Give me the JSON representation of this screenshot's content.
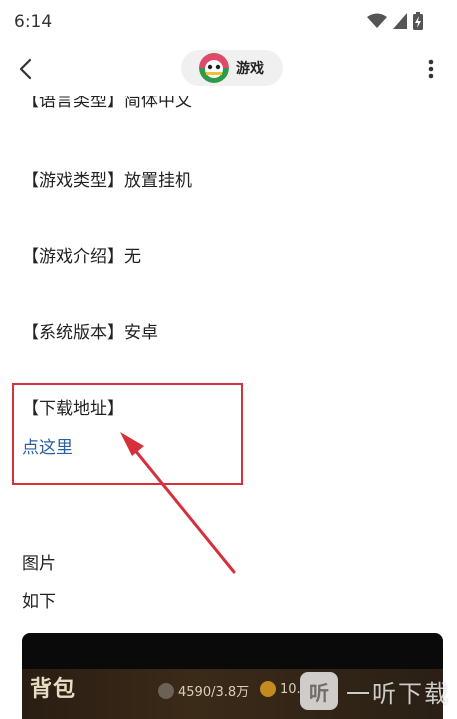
{
  "status_bar": {
    "time": "6:14",
    "icons": [
      "wifi-icon",
      "signal-icon",
      "battery-charging-icon"
    ]
  },
  "app_bar": {
    "back_icon": "chevron-left-icon",
    "title": "游戏",
    "more_icon": "more-vertical-icon"
  },
  "article": {
    "partial_line": "【语言类型】简体中文",
    "game_type": "【游戏类型】放置挂机",
    "game_intro": "【游戏介绍】无",
    "system_version": "【系统版本】安卓",
    "download_label": "【下载地址】",
    "download_link": "点这里",
    "images_label": "图片",
    "below_label": "如下"
  },
  "highlight_color": "#d6303c",
  "link_color": "#2b5f9e",
  "preview": {
    "title": "背包",
    "stat1": "4590/3.8万",
    "stat2": "10."
  },
  "watermark": {
    "badge": "听",
    "text": "一听下载"
  }
}
